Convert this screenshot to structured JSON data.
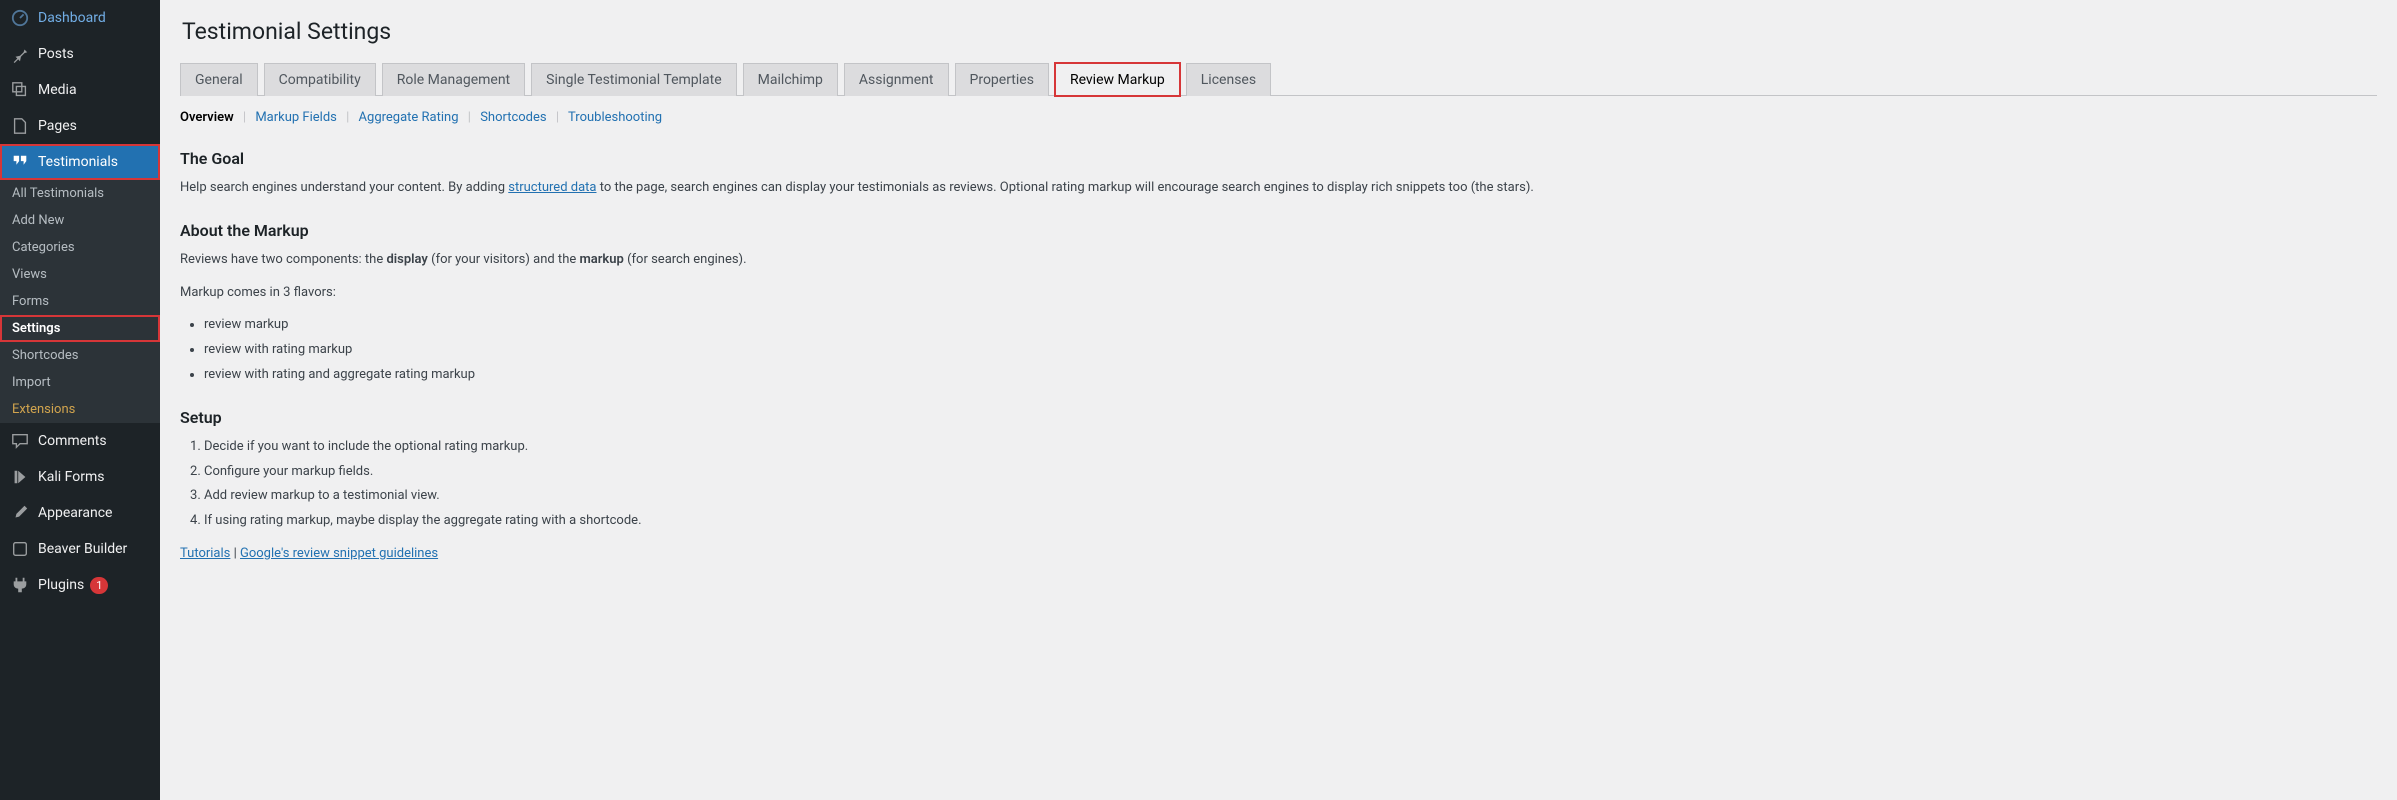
{
  "sidebar": {
    "dashboard": "Dashboard",
    "posts": "Posts",
    "media": "Media",
    "pages": "Pages",
    "testimonials": "Testimonials",
    "sub": {
      "all": "All Testimonials",
      "addnew": "Add New",
      "categories": "Categories",
      "views": "Views",
      "forms": "Forms",
      "settings": "Settings",
      "shortcodes": "Shortcodes",
      "import": "Import",
      "extensions": "Extensions"
    },
    "comments": "Comments",
    "kaliforms": "Kali Forms",
    "appearance": "Appearance",
    "beaver": "Beaver Builder",
    "plugins": "Plugins",
    "plugins_badge": "1"
  },
  "page_title": "Testimonial Settings",
  "tabs": {
    "general": "General",
    "compat": "Compatibility",
    "role": "Role Management",
    "single": "Single Testimonial Template",
    "mailchimp": "Mailchimp",
    "assignment": "Assignment",
    "properties": "Properties",
    "review": "Review Markup",
    "licenses": "Licenses"
  },
  "subnav": {
    "overview": "Overview",
    "markup_fields": "Markup Fields",
    "aggregate": "Aggregate Rating",
    "shortcodes": "Shortcodes",
    "troubleshooting": "Troubleshooting"
  },
  "content": {
    "goal_h": "The Goal",
    "goal_p1": "Help search engines understand your content. By adding ",
    "goal_link": "structured data",
    "goal_p2": " to the page, search engines can display your testimonials as reviews. Optional rating markup will encourage search engines to display rich snippets too (the stars).",
    "about_h": "About the Markup",
    "about_p1a": "Reviews have two components: the ",
    "about_p1b": "display",
    "about_p1c": " (for your visitors) and the ",
    "about_p1d": "markup",
    "about_p1e": " (for search engines).",
    "about_p2": "Markup comes in 3 flavors:",
    "flavors": {
      "f1": "review markup",
      "f2": "review with rating markup",
      "f3": "review with rating and aggregate rating markup"
    },
    "setup_h": "Setup",
    "steps": {
      "s1": "Decide if you want to include the optional rating markup.",
      "s2": "Configure your markup fields.",
      "s3": "Add review markup to a testimonial view.",
      "s4": "If using rating markup, maybe display the aggregate rating with a shortcode."
    },
    "footer": {
      "tutorials": "Tutorials",
      "sep": " | ",
      "google": "Google's review snippet guidelines"
    }
  }
}
